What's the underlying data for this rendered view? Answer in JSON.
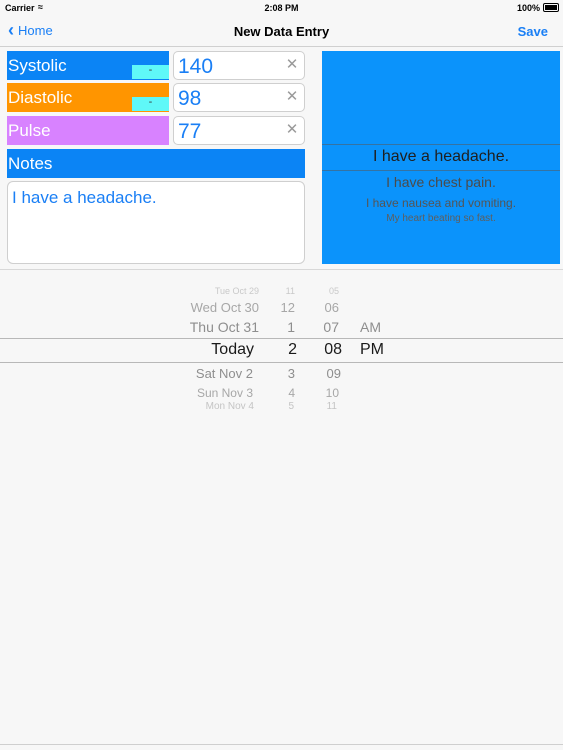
{
  "status_bar": {
    "carrier": "Carrier",
    "time": "2:08 PM",
    "battery": "100%"
  },
  "nav": {
    "back_label": "Home",
    "title": "New Data Entry",
    "save_label": "Save"
  },
  "vitals": [
    {
      "label": "Systolic",
      "value": "140",
      "minus": "-",
      "color": "#0b84f5"
    },
    {
      "label": "Diastolic",
      "value": "98",
      "minus": "-",
      "color": "#ff9500"
    },
    {
      "label": "Pulse",
      "value": "77",
      "color": "#d882ff"
    }
  ],
  "notes": {
    "header": "Notes",
    "text": "I have a headache.",
    "picker_options": [
      "I have a headache.",
      "I have chest pain.",
      "I have nausea and vomiting.",
      "My heart beating so fast."
    ]
  },
  "date_picker": {
    "rows": [
      {
        "date": "Tue Oct 29",
        "hour": "11",
        "minute": "05",
        "ampm": ""
      },
      {
        "date": "Wed Oct 30",
        "hour": "12",
        "minute": "06",
        "ampm": ""
      },
      {
        "date": "Thu Oct 31",
        "hour": "1",
        "minute": "07",
        "ampm": "AM"
      },
      {
        "date": "Today",
        "hour": "2",
        "minute": "08",
        "ampm": "PM"
      },
      {
        "date": "Sat Nov 2",
        "hour": "3",
        "minute": "09",
        "ampm": ""
      },
      {
        "date": "Sun Nov 3",
        "hour": "4",
        "minute": "10",
        "ampm": ""
      },
      {
        "date": "Mon Nov 4",
        "hour": "5",
        "minute": "11",
        "ampm": ""
      }
    ],
    "selected_index": 3
  }
}
